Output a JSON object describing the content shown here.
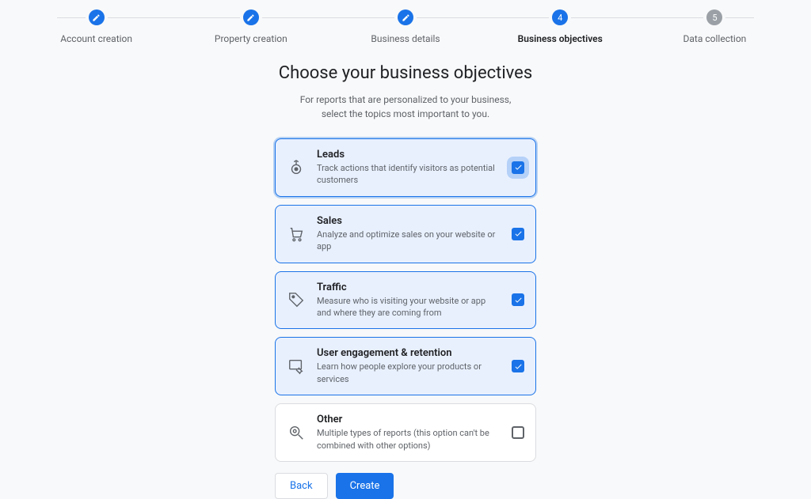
{
  "stepper": {
    "steps": [
      {
        "label": "Account creation",
        "state": "completed"
      },
      {
        "label": "Property creation",
        "state": "completed"
      },
      {
        "label": "Business details",
        "state": "completed"
      },
      {
        "label": "Business objectives",
        "state": "active",
        "number": "4"
      },
      {
        "label": "Data collection",
        "state": "inactive",
        "number": "5"
      }
    ]
  },
  "main": {
    "title": "Choose your business objectives",
    "subtitle_line1": "For reports that are personalized to your business,",
    "subtitle_line2": "select the topics most important to you."
  },
  "options": [
    {
      "key": "leads",
      "title": "Leads",
      "desc": "Track actions that identify visitors as potential customers",
      "checked": true,
      "focused": true
    },
    {
      "key": "sales",
      "title": "Sales",
      "desc": "Analyze and optimize sales on your website or app",
      "checked": true
    },
    {
      "key": "traffic",
      "title": "Traffic",
      "desc": "Measure who is visiting your website or app and where they are coming from",
      "checked": true
    },
    {
      "key": "engagement",
      "title": "User engagement & retention",
      "desc": "Learn how people explore your products or services",
      "checked": true
    },
    {
      "key": "other",
      "title": "Other",
      "desc": "Multiple types of reports (this option can't be combined with other options)",
      "checked": false
    }
  ],
  "footer": {
    "back_label": "Back",
    "create_label": "Create"
  }
}
